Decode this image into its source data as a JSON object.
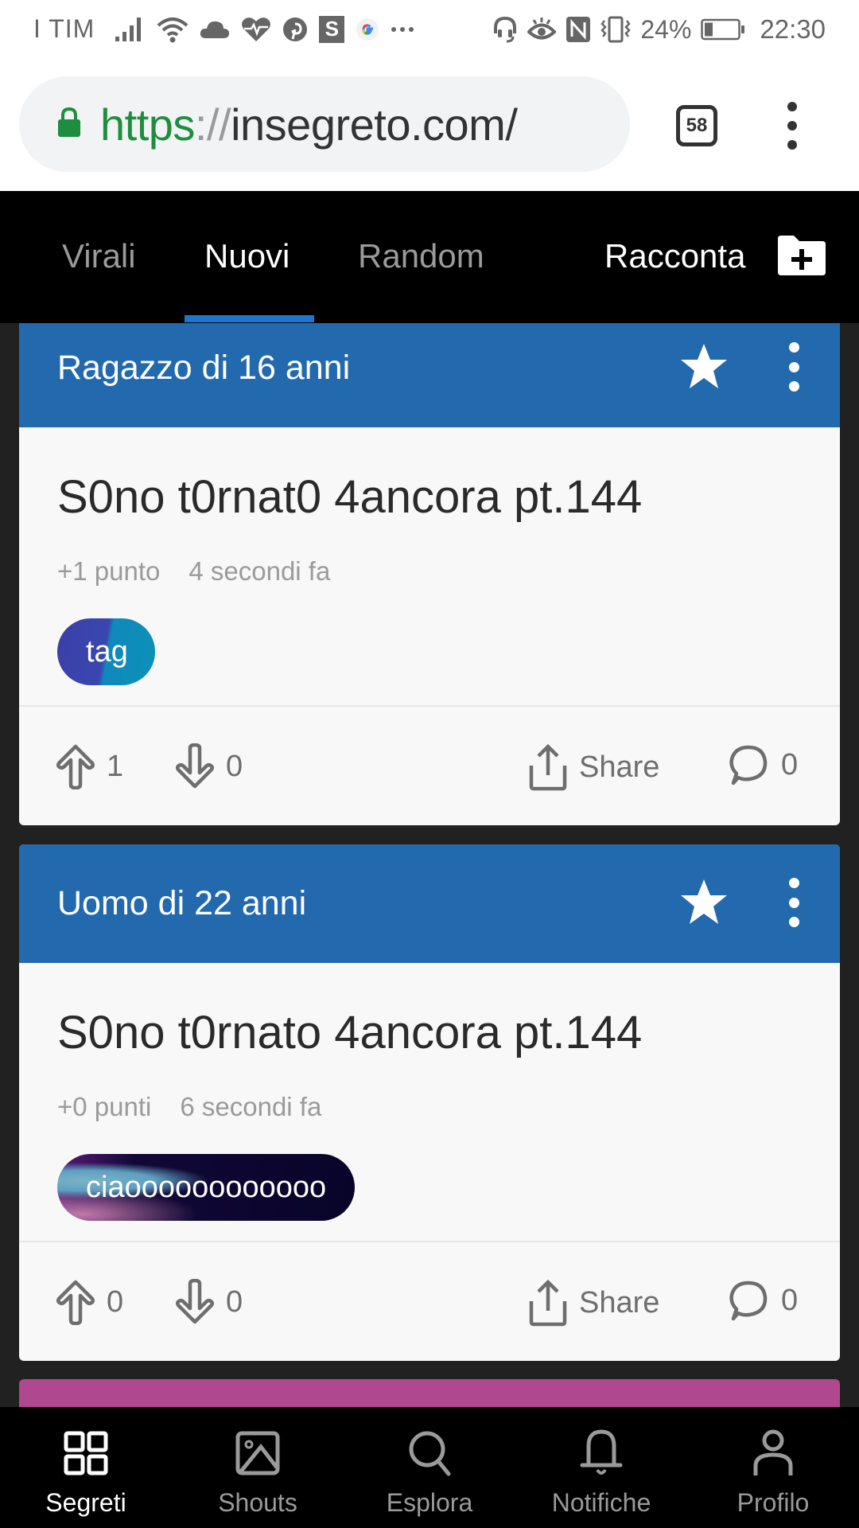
{
  "status_bar": {
    "carrier": "I TIM",
    "notification_icons": [
      "signal-icon",
      "wifi-icon",
      "cloud-icon",
      "heart-rate-icon",
      "pinterest-icon",
      "s-app-icon",
      "google-icon",
      "more-dots-icon"
    ],
    "system_icons": [
      "headset-icon",
      "eye-icon",
      "nfc-icon",
      "vibrate-icon"
    ],
    "battery_percent": "24%",
    "battery_level": 0.24,
    "time": "22:30"
  },
  "browser": {
    "url_scheme": "https",
    "url_separator": "://",
    "url_host": "insegreto.com/",
    "tab_count": "58",
    "secure": true,
    "secure_color": "#1e8e3e"
  },
  "site_nav": {
    "tabs": [
      {
        "label": "Virali",
        "active": false
      },
      {
        "label": "Nuovi",
        "active": true
      },
      {
        "label": "Random",
        "active": false
      }
    ],
    "action_label": "Racconta",
    "accent_color": "#1976d2"
  },
  "posts": [
    {
      "author": "Ragazzo di 16 anni",
      "header_color": "#2369ae",
      "title": "S0no t0rnat0 4ancora pt.144",
      "points": "+1 punto",
      "time_ago": "4 secondi fa",
      "tag": "tag",
      "upvotes": "1",
      "downvotes": "0",
      "share_label": "Share",
      "comments": "0"
    },
    {
      "author": "Uomo di 22 anni",
      "header_color": "#2369ae",
      "title": "S0no t0rnato 4ancora pt.144",
      "points": "+0 punti",
      "time_ago": "6 secondi fa",
      "tag": "ciaoooooooooooo",
      "upvotes": "0",
      "downvotes": "0",
      "share_label": "Share",
      "comments": "0"
    },
    {
      "header_color": "#b0488f"
    }
  ],
  "bottom_nav": {
    "items": [
      {
        "label": "Segreti",
        "icon": "grid-icon",
        "active": true
      },
      {
        "label": "Shouts",
        "icon": "image-icon",
        "active": false
      },
      {
        "label": "Esplora",
        "icon": "search-icon",
        "active": false
      },
      {
        "label": "Notifiche",
        "icon": "bell-icon",
        "active": false
      },
      {
        "label": "Profilo",
        "icon": "profile-icon",
        "active": false
      }
    ]
  }
}
